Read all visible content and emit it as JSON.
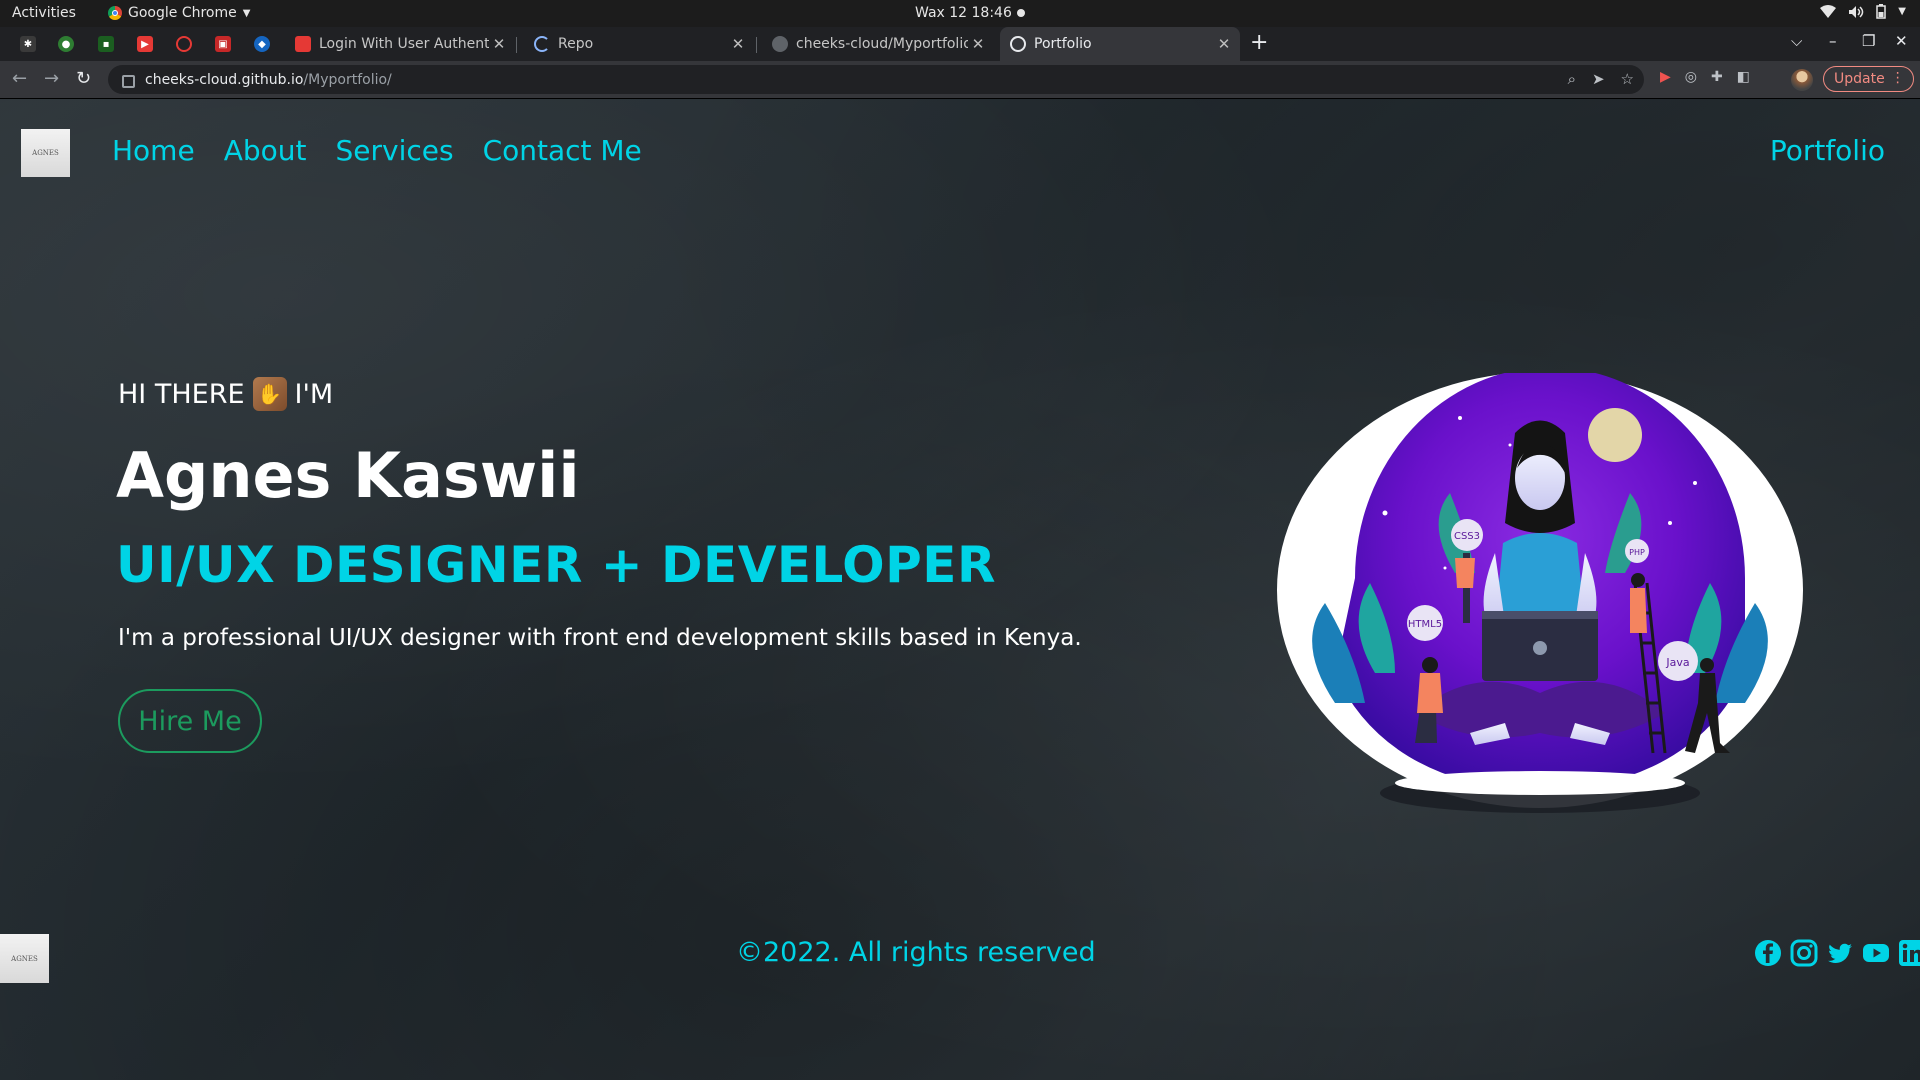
{
  "os_bar": {
    "activities": "Activities",
    "app_name": "Google Chrome",
    "clock": "Wax 12  18:46"
  },
  "browser": {
    "tabs": [
      {
        "label": "Login With User Authenti",
        "icon": "youtube-icon"
      },
      {
        "label": "Repo",
        "icon": "loading-spinner-icon"
      },
      {
        "label": "cheeks-cloud/Myportfolio",
        "icon": "github-icon"
      },
      {
        "label": "Portfolio",
        "icon": "globe-icon",
        "active": true
      }
    ],
    "url_host": "cheeks-cloud.github.io",
    "url_path": "/Myportfolio/",
    "update_label": "Update"
  },
  "site": {
    "logo_text": "AGNES",
    "nav": [
      "Home",
      "About",
      "Services",
      "Contact Me"
    ],
    "brand": "Portfolio",
    "greeting_before": "HI THERE",
    "greeting_after": "I'M",
    "name": "Agnes Kaswii",
    "role": "UI/UX DESIGNER + DEVELOPER",
    "description": "I'm a professional UI/UX designer with front end development skills based in Kenya.",
    "hire_button": "Hire Me",
    "illustration_badges": [
      "CSS3",
      "PHP",
      "HTML5",
      "Java"
    ],
    "footer": {
      "copyright": "©2022. All rights reserved",
      "socials": [
        "facebook-icon",
        "instagram-icon",
        "twitter-icon",
        "youtube-icon",
        "linkedin-icon"
      ]
    },
    "colors": {
      "accent": "#00d4e6",
      "button": "#1c9b5e"
    }
  }
}
